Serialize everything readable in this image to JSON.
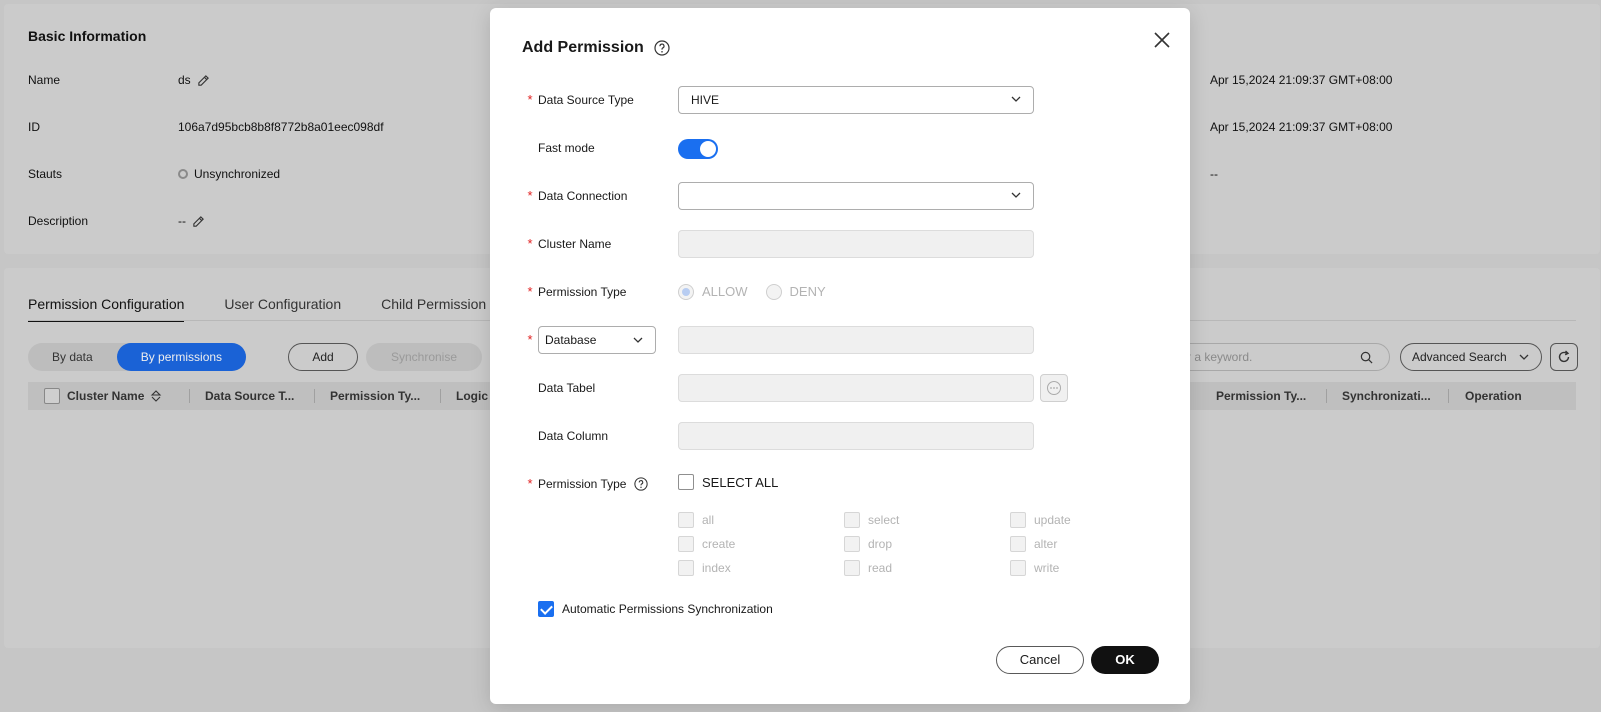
{
  "basic_info": {
    "title": "Basic Information",
    "fields": [
      {
        "label": "Name",
        "value": "ds"
      },
      {
        "label": "ID",
        "value": "106a7d95bcb8b8f8772b8a01eec098df"
      },
      {
        "label": "Stauts",
        "value": "Unsynchronized"
      },
      {
        "label": "Description",
        "value": "--"
      }
    ],
    "right_values": [
      "Apr 15,2024 21:09:37 GMT+08:00",
      "Apr 15,2024 21:09:37 GMT+08:00",
      "--"
    ]
  },
  "tabs": [
    "Permission Configuration",
    "User Configuration",
    "Child Permission"
  ],
  "toolbar": {
    "seg_by_data": "By data",
    "seg_by_permissions": "By permissions",
    "add": "Add",
    "synchronise": "Synchronise",
    "search_placeholder_visible": "r a keyword.",
    "advanced_search": "Advanced Search"
  },
  "table_headers_left": [
    "Cluster Name",
    "Data Source T...",
    "Permission Ty...",
    "Logic"
  ],
  "table_headers_right": [
    "Permission Ty...",
    "Synchronizati...",
    "Operation"
  ],
  "modal": {
    "title": "Add Permission",
    "data_source_type_label": "Data Source Type",
    "data_source_type_value": "HIVE",
    "fast_mode_label": "Fast mode",
    "data_connection_label": "Data Connection",
    "data_connection_value": "",
    "cluster_name_label": "Cluster Name",
    "permission_type_label": "Permission Type",
    "allow": "ALLOW",
    "deny": "DENY",
    "database_select": "Database",
    "data_table_label": "Data Tabel",
    "data_column_label": "Data Column",
    "permission_type2_label": "Permission Type",
    "select_all": "SELECT ALL",
    "permissions": [
      "all",
      "select",
      "update",
      "create",
      "drop",
      "alter",
      "index",
      "read",
      "write"
    ],
    "auto_sync": "Automatic Permissions Synchronization",
    "cancel": "Cancel",
    "ok": "OK"
  }
}
